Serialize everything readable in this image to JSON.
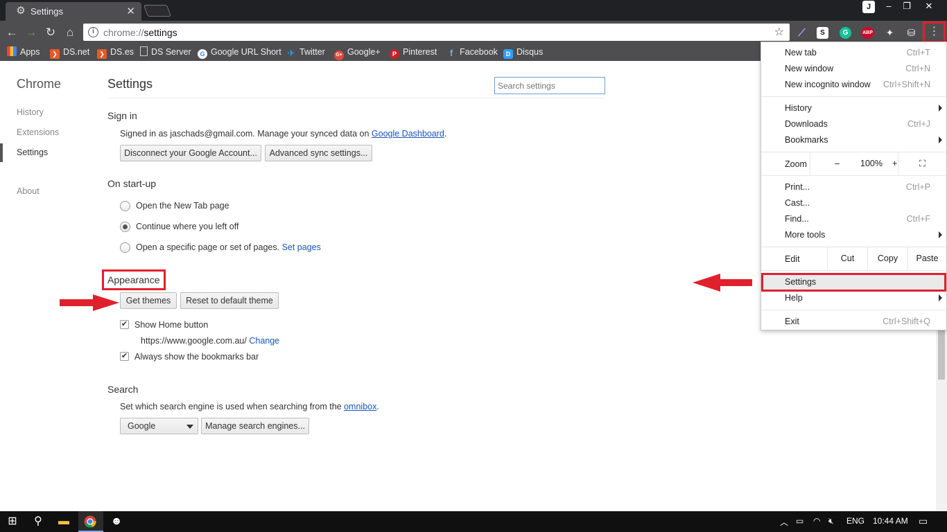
{
  "tab": {
    "title": "Settings",
    "icon": "gear-icon",
    "close": "✕"
  },
  "window": {
    "profile": "J",
    "minimize": "–",
    "restore": "❐",
    "close": "✕"
  },
  "toolbar": {
    "url_scheme": "chrome://",
    "url_path": "settings",
    "extensions": [
      "quill-icon",
      "S",
      "G",
      "ABP",
      "puzzle-icon",
      "basket-icon"
    ]
  },
  "bookmarks": [
    {
      "label": "Apps",
      "icon": "apps-grid-icon",
      "color": "#e8453c"
    },
    {
      "label": "DS.net",
      "icon": "ds-shield-icon",
      "color": "#e55b25"
    },
    {
      "label": "DS.es",
      "icon": "ds-shield-icon",
      "color": "#e55b25"
    },
    {
      "label": "DS Server",
      "icon": "page-icon",
      "color": "#cccccc"
    },
    {
      "label": "Google URL Short",
      "icon": "google-icon",
      "color": "#ffffff"
    },
    {
      "label": "Twitter",
      "icon": "twitter-icon",
      "color": "#1da1f2"
    },
    {
      "label": "Google+",
      "icon": "google-plus-icon",
      "color": "#dd4b39"
    },
    {
      "label": "Pinterest",
      "icon": "pinterest-icon",
      "color": "#cb2027"
    },
    {
      "label": "Facebook",
      "icon": "facebook-icon",
      "color": "#3b5998"
    },
    {
      "label": "Disqus",
      "icon": "disqus-icon",
      "color": "#2e9fff"
    }
  ],
  "sidebar": {
    "brand": "Chrome",
    "items": [
      {
        "label": "History"
      },
      {
        "label": "Extensions"
      },
      {
        "label": "Settings"
      },
      {
        "label": "About"
      }
    ]
  },
  "settings": {
    "title": "Settings",
    "search_placeholder": "Search settings",
    "signin": {
      "heading": "Sign in",
      "text": "Signed in as jaschads@gmail.com. Manage your synced data on",
      "link": "Google Dashboard",
      "after": ".",
      "disconnect_label": "Disconnect your Google Account...",
      "advanced_label": "Advanced sync settings..."
    },
    "startup": {
      "heading": "On start-up",
      "options": [
        {
          "label": "Open the New Tab page",
          "selected": false
        },
        {
          "label": "Continue where you left off",
          "selected": true
        },
        {
          "label": "Open a specific page or set of pages.",
          "selected": false
        }
      ],
      "set_pages_link": "Set pages"
    },
    "appearance": {
      "heading": "Appearance",
      "get_themes_label": "Get themes",
      "reset_theme_label": "Reset to default theme",
      "show_home_label": "Show Home button",
      "home_url": "https://www.google.com.au/",
      "change_link": "Change",
      "bookmarks_bar_label": "Always show the bookmarks bar"
    },
    "search": {
      "heading": "Search",
      "text": "Set which search engine is used when searching from the",
      "omnibox_link": "omnibox",
      "after": ".",
      "engine": "Google",
      "manage_label": "Manage search engines..."
    }
  },
  "menu": {
    "new_tab": {
      "label": "New tab",
      "shortcut": "Ctrl+T"
    },
    "new_window": {
      "label": "New window",
      "shortcut": "Ctrl+N"
    },
    "incognito": {
      "label": "New incognito window",
      "shortcut": "Ctrl+Shift+N"
    },
    "history": {
      "label": "History"
    },
    "downloads": {
      "label": "Downloads",
      "shortcut": "Ctrl+J"
    },
    "bookmarks": {
      "label": "Bookmarks"
    },
    "zoom": {
      "label": "Zoom",
      "minus": "–",
      "value": "100%",
      "plus": "+"
    },
    "print": {
      "label": "Print...",
      "shortcut": "Ctrl+P"
    },
    "cast": {
      "label": "Cast..."
    },
    "find": {
      "label": "Find...",
      "shortcut": "Ctrl+F"
    },
    "more_tools": {
      "label": "More tools"
    },
    "edit": {
      "label": "Edit",
      "cut": "Cut",
      "copy": "Copy",
      "paste": "Paste"
    },
    "settings": {
      "label": "Settings"
    },
    "help": {
      "label": "Help"
    },
    "exit": {
      "label": "Exit",
      "shortcut": "Ctrl+Shift+Q"
    }
  },
  "taskbar": {
    "language": "ENG",
    "time": "10:44 AM"
  },
  "colors": {
    "highlight_red": "#e1202e",
    "link_blue": "#1a55b8",
    "chrome_dark": "#4e4e50"
  }
}
